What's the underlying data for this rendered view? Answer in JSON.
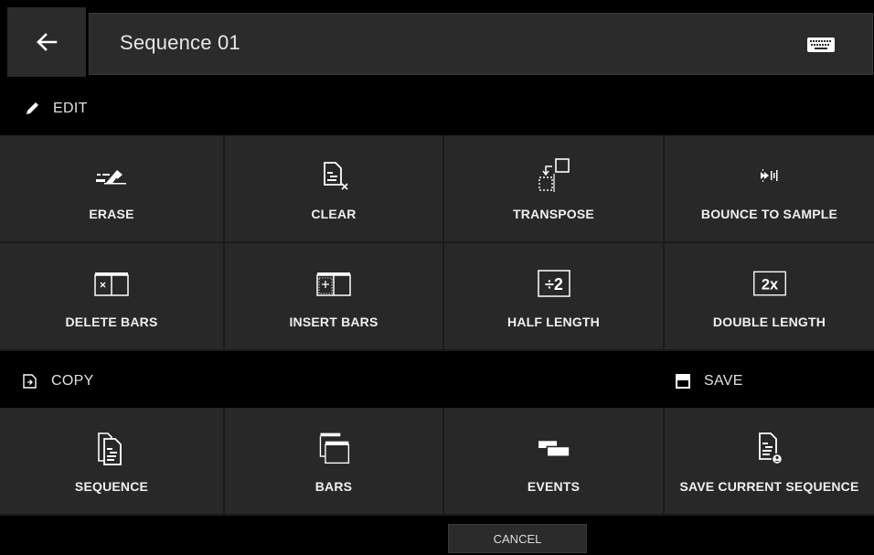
{
  "header": {
    "title": "Sequence 01"
  },
  "edit_section": {
    "label": "EDIT"
  },
  "edit_items": [
    {
      "label": "ERASE",
      "icon": "erase-icon"
    },
    {
      "label": "CLEAR",
      "icon": "clear-icon"
    },
    {
      "label": "TRANSPOSE",
      "icon": "transpose-icon"
    },
    {
      "label": "BOUNCE TO SAMPLE",
      "icon": "bounce-icon"
    },
    {
      "label": "DELETE BARS",
      "icon": "delete-bars-icon"
    },
    {
      "label": "INSERT BARS",
      "icon": "insert-bars-icon"
    },
    {
      "label": "HALF LENGTH",
      "icon": "half-length-icon",
      "glyph": "÷2"
    },
    {
      "label": "DOUBLE LENGTH",
      "icon": "double-length-icon",
      "glyph": "2x"
    }
  ],
  "copy_section": {
    "label": "COPY"
  },
  "save_section": {
    "label": "SAVE"
  },
  "copy_items": [
    {
      "label": "SEQUENCE",
      "icon": "copy-sequence-icon"
    },
    {
      "label": "BARS",
      "icon": "copy-bars-icon"
    },
    {
      "label": "EVENTS",
      "icon": "copy-events-icon"
    },
    {
      "label": "SAVE CURRENT SEQUENCE",
      "icon": "save-sequence-icon"
    }
  ],
  "footer": {
    "cancel_label": "CANCEL"
  }
}
